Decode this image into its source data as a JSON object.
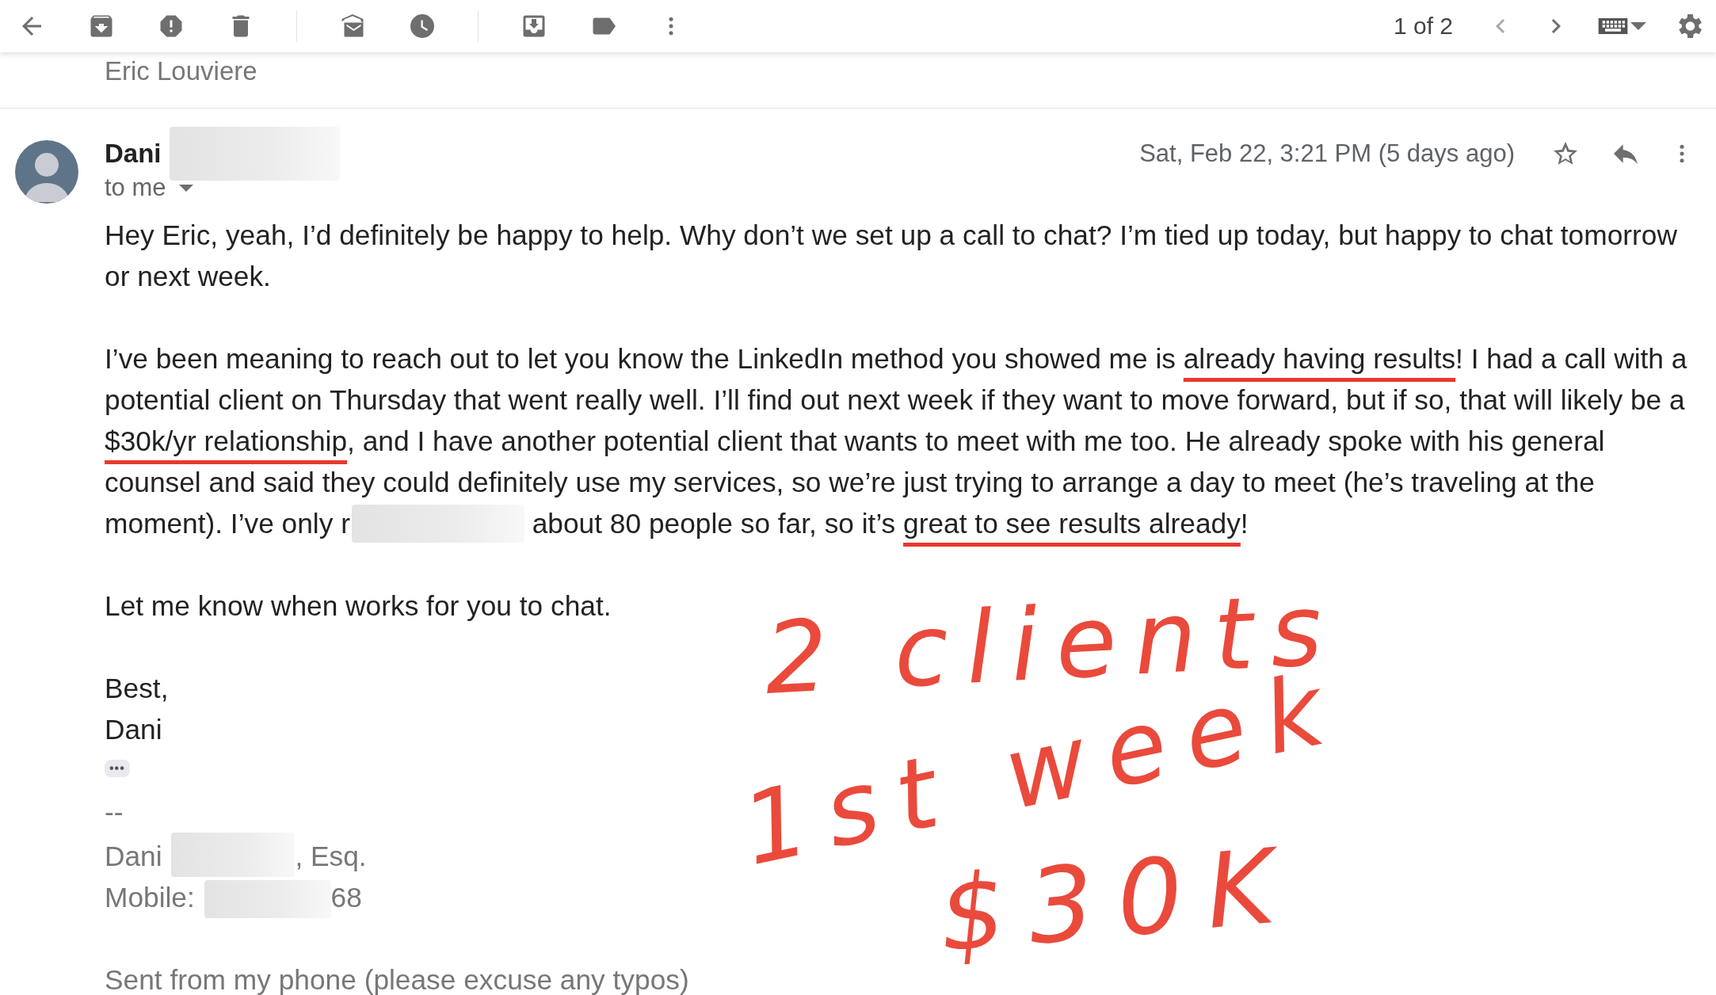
{
  "toolbar": {
    "pager": "1 of 2"
  },
  "previous_message": {
    "sender": "Eric Louviere"
  },
  "message": {
    "sender": "Dani",
    "recipient": "to me",
    "date": "Sat, Feb 22, 3:21 PM (5 days ago)",
    "starred": false,
    "paragraphs": [
      [
        {
          "kind": "text",
          "text": "Hey Eric, yeah, I’d definitely be happy to help. Why don’t we set up a call to chat? I’m tied up today, but happy to chat tomorrow or next week."
        }
      ],
      [
        {
          "kind": "text",
          "text": "I’ve been meaning to reach out to let you know the LinkedIn method you showed me is "
        },
        {
          "kind": "underlined",
          "text": "already having results"
        },
        {
          "kind": "text",
          "text": "! I had a call with a potential client on Thursday that went really well. I’ll find out next week if they want to move forward, but if so, that will likely be a "
        },
        {
          "kind": "underlined",
          "text": "$30k/yr relationship"
        },
        {
          "kind": "text",
          "text": ", and I have another potential client that wants to meet with me too. He already spoke with his general counsel and said they could definitely use my services, so we’re just trying to arrange a day to meet (he’s traveling at the moment). I’ve only r"
        },
        {
          "kind": "redaction"
        },
        {
          "kind": "text",
          "text": " about 80 people so far, so it’s "
        },
        {
          "kind": "underlined",
          "text": "great to see results already"
        },
        {
          "kind": "text",
          "text": "!"
        }
      ],
      [
        {
          "kind": "text",
          "text": "Let me know when works for you to chat."
        }
      ]
    ],
    "closing": [
      "Best,",
      "Dani"
    ],
    "trimmed_label": "•••",
    "signature": {
      "separator": "--",
      "lines": [
        [
          {
            "kind": "text",
            "text": "Dani "
          },
          {
            "kind": "redaction"
          },
          {
            "kind": "text",
            "text": ", Esq."
          }
        ],
        [
          {
            "kind": "text",
            "text": "Mobile: "
          },
          {
            "kind": "redaction"
          },
          {
            "kind": "text",
            "text": "68"
          }
        ]
      ],
      "footer": "Sent from my phone (please excuse any typos)"
    }
  },
  "annotations": [
    {
      "text": "2 clients"
    },
    {
      "text": "1st week"
    },
    {
      "text": "$30K"
    }
  ]
}
